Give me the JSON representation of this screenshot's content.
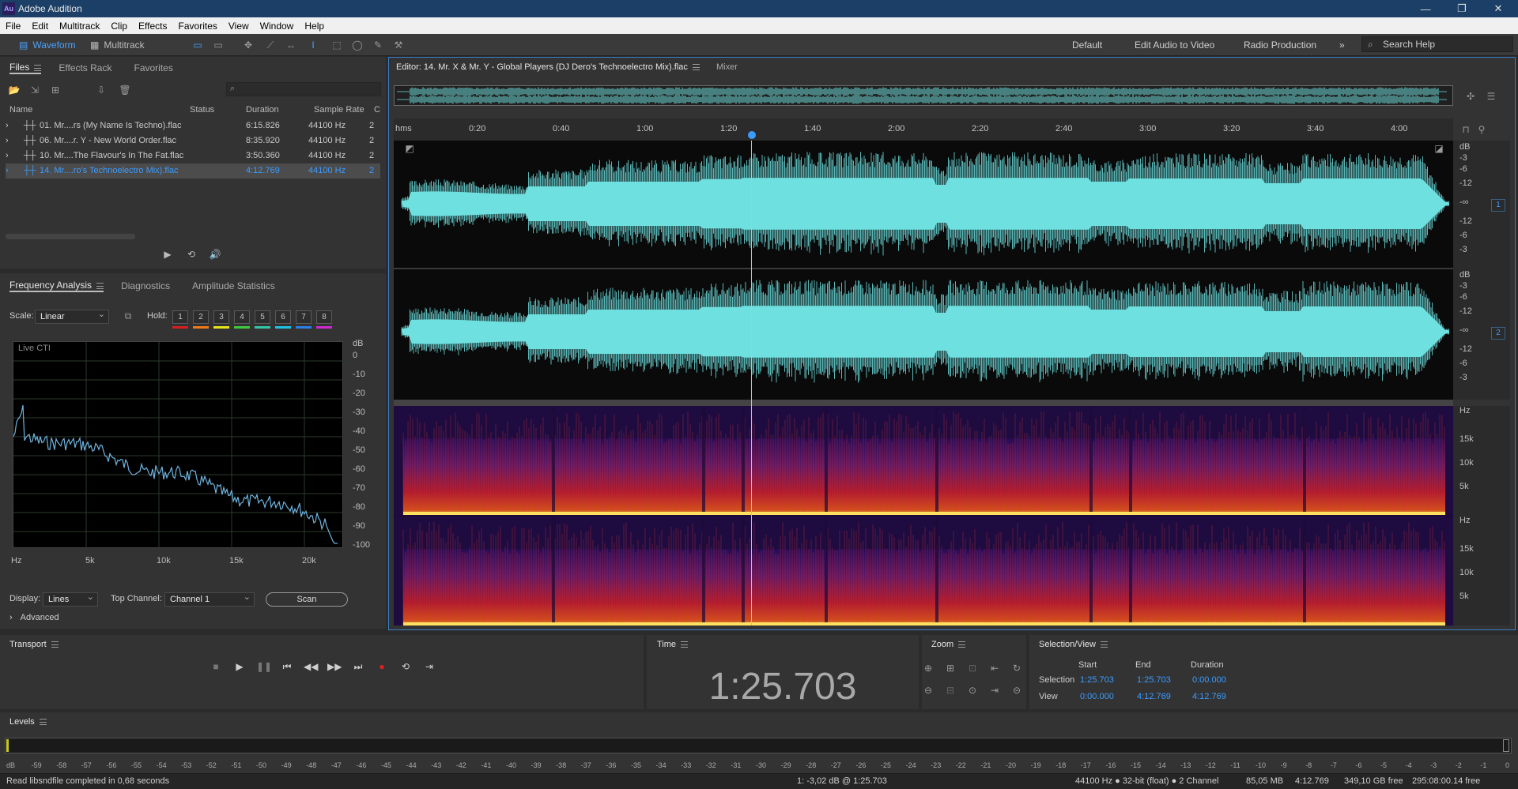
{
  "app": {
    "title": "Adobe Audition",
    "logo": "Au"
  },
  "menu": [
    "File",
    "Edit",
    "Multitrack",
    "Clip",
    "Effects",
    "Favorites",
    "View",
    "Window",
    "Help"
  ],
  "toolbar": {
    "waveform": "Waveform",
    "multitrack": "Multitrack"
  },
  "workspaces": [
    "Default",
    "Edit Audio to Video",
    "Radio Production"
  ],
  "search": {
    "placeholder": "Search Help"
  },
  "files_panel": {
    "tabs": [
      "Files",
      "Effects Rack",
      "Favorites"
    ],
    "columns": {
      "name": "Name",
      "status": "Status",
      "duration": "Duration",
      "rate": "Sample Rate",
      "c": "C"
    },
    "rows": [
      {
        "name": "01. Mr....rs (My Name Is Techno).flac",
        "duration": "6:15.826",
        "rate": "44100 Hz",
        "c": "2"
      },
      {
        "name": "06. Mr....r. Y - New World Order.flac",
        "duration": "8:35.920",
        "rate": "44100 Hz",
        "c": "2"
      },
      {
        "name": "10. Mr....The Flavour's In The Fat.flac",
        "duration": "3:50.360",
        "rate": "44100 Hz",
        "c": "2"
      },
      {
        "name": "14. Mr....ro's Technoelectro Mix).flac",
        "duration": "4:12.769",
        "rate": "44100 Hz",
        "c": "2"
      }
    ]
  },
  "freq_panel": {
    "tabs": [
      "Frequency Analysis",
      "Diagnostics",
      "Amplitude Statistics"
    ],
    "scale_label": "Scale:",
    "scale_value": "Linear",
    "hold_label": "Hold:",
    "holds": [
      "1",
      "2",
      "3",
      "4",
      "5",
      "6",
      "7",
      "8"
    ],
    "hold_colors": [
      "#d81f1f",
      "#f07a16",
      "#e6e619",
      "#3fc93f",
      "#32c8a8",
      "#1fc3e6",
      "#2f7fe6",
      "#d22ad2"
    ],
    "graph_label": "Live CTI",
    "db_unit": "dB",
    "db_ticks": [
      "0",
      "-10",
      "-20",
      "-30",
      "-40",
      "-50",
      "-60",
      "-70",
      "-80",
      "-90",
      "-100"
    ],
    "hz_ticks": [
      "Hz",
      "5k",
      "10k",
      "15k",
      "20k"
    ],
    "display_label": "Display:",
    "display_value": "Lines",
    "top_channel_label": "Top Channel:",
    "top_channel_value": "Channel 1",
    "scan": "Scan",
    "advanced": "Advanced"
  },
  "editor": {
    "tab": "Editor: 14. Mr. X & Mr. Y - Global Players (DJ Dero's Technoelectro Mix).flac",
    "mixer": "Mixer",
    "ruler": [
      "hms",
      "0:20",
      "0:40",
      "1:00",
      "1:20",
      "1:40",
      "2:00",
      "2:20",
      "2:40",
      "3:00",
      "3:20",
      "3:40",
      "4:00"
    ],
    "db_labels": [
      "dB",
      "-3",
      "-6",
      "-12",
      "-∞",
      "-12",
      "-6",
      "-3"
    ],
    "ch1": "1",
    "ch2": "2",
    "hz_labels": [
      "Hz",
      "15k",
      "10k",
      "5k"
    ],
    "waveform_color": "#6fe0e0",
    "playhead_color": "#e0d21a"
  },
  "transport": {
    "title": "Transport"
  },
  "time": {
    "title": "Time",
    "value": "1:25.703"
  },
  "zoom": {
    "title": "Zoom"
  },
  "selection": {
    "title": "Selection/View",
    "start": "Start",
    "end": "End",
    "duration": "Duration",
    "selection_label": "Selection",
    "view_label": "View",
    "sel_start": "1:25.703",
    "sel_end": "1:25.703",
    "sel_dur": "0:00.000",
    "view_start": "0:00.000",
    "view_end": "4:12.769",
    "view_dur": "4:12.769"
  },
  "levels": {
    "title": "Levels",
    "ticks": [
      "dB",
      "-59",
      "-58",
      "-57",
      "-56",
      "-55",
      "-54",
      "-53",
      "-52",
      "-51",
      "-50",
      "-49",
      "-48",
      "-47",
      "-46",
      "-45",
      "-44",
      "-43",
      "-42",
      "-41",
      "-40",
      "-39",
      "-38",
      "-37",
      "-36",
      "-35",
      "-34",
      "-33",
      "-32",
      "-31",
      "-30",
      "-29",
      "-28",
      "-27",
      "-26",
      "-25",
      "-24",
      "-23",
      "-22",
      "-21",
      "-20",
      "-19",
      "-18",
      "-17",
      "-16",
      "-15",
      "-14",
      "-13",
      "-12",
      "-11",
      "-10",
      "-9",
      "-8",
      "-7",
      "-6",
      "-5",
      "-4",
      "-3",
      "-2",
      "-1",
      "0"
    ]
  },
  "status": {
    "message": "Read libsndfile completed in 0,68 seconds",
    "cursor": "1: -3,02 dB @ 1:25.703",
    "format": "44100 Hz ● 32-bit (float) ● 2 Channel",
    "size": "85,05 MB",
    "duration": "4:12.769",
    "free": "349,10 GB free",
    "free_time": "295:08:00.14 free"
  }
}
